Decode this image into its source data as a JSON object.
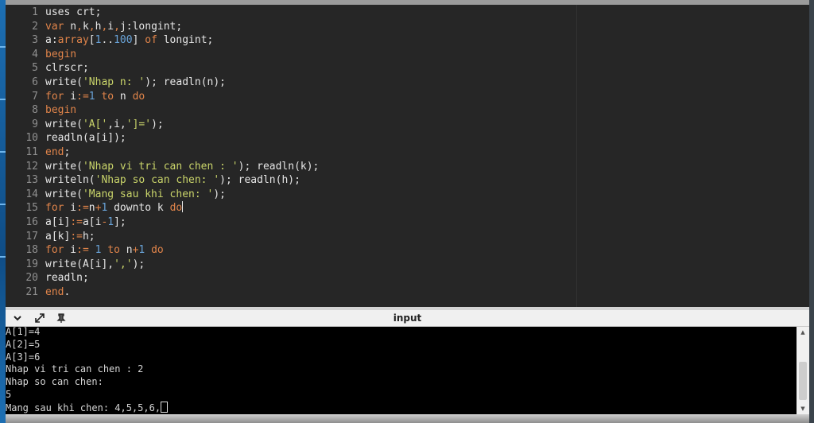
{
  "editor": {
    "lines": [
      {
        "num": "1",
        "tokens": [
          [
            "plain",
            "uses crt;"
          ]
        ]
      },
      {
        "num": "2",
        "tokens": [
          [
            "kw",
            "var"
          ],
          [
            "plain",
            " n"
          ],
          [
            "op",
            ","
          ],
          [
            "plain",
            "k"
          ],
          [
            "op",
            ","
          ],
          [
            "plain",
            "h"
          ],
          [
            "op",
            ","
          ],
          [
            "plain",
            "i"
          ],
          [
            "op",
            ","
          ],
          [
            "plain",
            "j:longint;"
          ]
        ]
      },
      {
        "num": "3",
        "tokens": [
          [
            "plain",
            "a:"
          ],
          [
            "kw",
            "array"
          ],
          [
            "plain",
            "["
          ],
          [
            "num",
            "1"
          ],
          [
            "plain",
            ".."
          ],
          [
            "num",
            "100"
          ],
          [
            "plain",
            "] "
          ],
          [
            "kw",
            "of"
          ],
          [
            "plain",
            " longint;"
          ]
        ]
      },
      {
        "num": "4",
        "tokens": [
          [
            "kw",
            "begin"
          ]
        ]
      },
      {
        "num": "5",
        "tokens": [
          [
            "plain",
            "clrscr;"
          ]
        ]
      },
      {
        "num": "6",
        "tokens": [
          [
            "plain",
            "write("
          ],
          [
            "str",
            "'Nhap n: '"
          ],
          [
            "plain",
            "); readln(n);"
          ]
        ]
      },
      {
        "num": "7",
        "tokens": [
          [
            "kw",
            "for"
          ],
          [
            "plain",
            " i"
          ],
          [
            "op",
            ":="
          ],
          [
            "num",
            "1"
          ],
          [
            "plain",
            " "
          ],
          [
            "kw",
            "to"
          ],
          [
            "plain",
            " n "
          ],
          [
            "kw",
            "do"
          ]
        ]
      },
      {
        "num": "8",
        "tokens": [
          [
            "kw",
            "begin"
          ]
        ]
      },
      {
        "num": "9",
        "tokens": [
          [
            "plain",
            "write("
          ],
          [
            "str",
            "'A['"
          ],
          [
            "plain",
            ",i,"
          ],
          [
            "str",
            "']='"
          ],
          [
            "plain",
            ");"
          ]
        ]
      },
      {
        "num": "10",
        "tokens": [
          [
            "plain",
            "readln(a[i]);"
          ]
        ]
      },
      {
        "num": "11",
        "tokens": [
          [
            "kw",
            "end"
          ],
          [
            "plain",
            ";"
          ]
        ]
      },
      {
        "num": "12",
        "tokens": [
          [
            "plain",
            "write("
          ],
          [
            "str",
            "'Nhap vi tri can chen : '"
          ],
          [
            "plain",
            "); readln(k);"
          ]
        ]
      },
      {
        "num": "13",
        "tokens": [
          [
            "plain",
            "writeln("
          ],
          [
            "str",
            "'Nhap so can chen: '"
          ],
          [
            "plain",
            "); readln(h);"
          ]
        ]
      },
      {
        "num": "14",
        "tokens": [
          [
            "plain",
            "write("
          ],
          [
            "str",
            "'Mang sau khi chen: '"
          ],
          [
            "plain",
            ");"
          ]
        ]
      },
      {
        "num": "15",
        "tokens": [
          [
            "kw",
            "for"
          ],
          [
            "plain",
            " i"
          ],
          [
            "op",
            ":="
          ],
          [
            "plain",
            "n"
          ],
          [
            "op",
            "+"
          ],
          [
            "num",
            "1"
          ],
          [
            "plain",
            " downto k "
          ],
          [
            "kw",
            "do"
          ]
        ],
        "cursor": true
      },
      {
        "num": "16",
        "tokens": [
          [
            "plain",
            "a[i]"
          ],
          [
            "op",
            ":="
          ],
          [
            "plain",
            "a[i"
          ],
          [
            "op",
            "-"
          ],
          [
            "num",
            "1"
          ],
          [
            "plain",
            "];"
          ]
        ]
      },
      {
        "num": "17",
        "tokens": [
          [
            "plain",
            "a[k]"
          ],
          [
            "op",
            ":="
          ],
          [
            "plain",
            "h;"
          ]
        ]
      },
      {
        "num": "18",
        "tokens": [
          [
            "kw",
            "for"
          ],
          [
            "plain",
            " i"
          ],
          [
            "op",
            ":="
          ],
          [
            "plain",
            " "
          ],
          [
            "num",
            "1"
          ],
          [
            "plain",
            " "
          ],
          [
            "kw",
            "to"
          ],
          [
            "plain",
            " n"
          ],
          [
            "op",
            "+"
          ],
          [
            "num",
            "1"
          ],
          [
            "plain",
            " "
          ],
          [
            "kw",
            "do"
          ]
        ]
      },
      {
        "num": "19",
        "tokens": [
          [
            "plain",
            "write(A[i],"
          ],
          [
            "str",
            "','"
          ],
          [
            "plain",
            ");"
          ]
        ]
      },
      {
        "num": "20",
        "tokens": [
          [
            "plain",
            "readln;"
          ]
        ]
      },
      {
        "num": "21",
        "tokens": [
          [
            "kw",
            "end"
          ],
          [
            "plain",
            "."
          ]
        ]
      }
    ]
  },
  "panel": {
    "title": "input",
    "collapse_icon": "chevron-down-icon",
    "expand_icon": "expand-arrows-icon",
    "pin_icon": "pin-icon"
  },
  "console": {
    "lines": [
      "A[1]=4",
      "A[2]=5",
      "A[3]=6",
      "Nhap vi tri can chen : 2",
      "Nhap so can chen:",
      "5",
      "Mang sau khi chen: 4,5,5,6,"
    ]
  },
  "colors": {
    "editor_bg": "#262626",
    "keyword": "#e0844a",
    "string": "#c9d46a",
    "number": "#69a3d8",
    "console_bg": "#000000"
  }
}
